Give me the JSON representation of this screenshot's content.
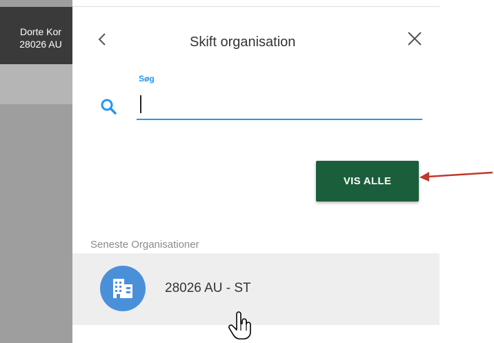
{
  "user": {
    "name": "Dorte Kor",
    "org": "28026 AU"
  },
  "dialog": {
    "title": "Skift organisation",
    "search_label": "Søg",
    "search_value": "",
    "show_all_label": "VIS ALLE",
    "recent_heading": "Seneste Organisationer",
    "recent_items": [
      {
        "label": "28026 AU - ST",
        "icon": "building-icon"
      }
    ]
  },
  "colors": {
    "accent": "#2196f3",
    "button": "#1b5e3b",
    "avatar": "#4a90d9",
    "arrow": "#c0392b"
  }
}
